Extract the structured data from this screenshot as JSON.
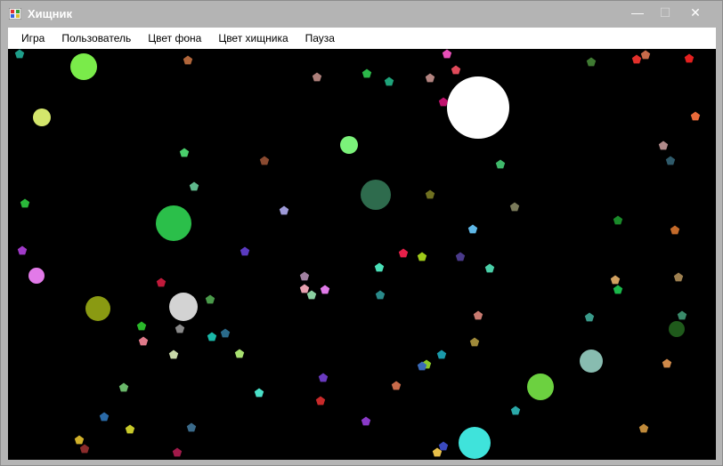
{
  "window": {
    "title": "Хищник",
    "min_symbol": "—",
    "max_symbol": "☐",
    "close_symbol": "✕"
  },
  "menu": {
    "items": [
      "Игра",
      "Пользователь",
      "Цвет фона",
      "Цвет хищника",
      "Пауза"
    ]
  },
  "game": {
    "background_color": "#000000",
    "predators": [
      {
        "color": "#ffffff"
      },
      {
        "color": "#2bbf4a"
      },
      {
        "color": "#2e6b4d"
      },
      {
        "color": "#d3d3d3"
      },
      {
        "color": "#7aeb4a"
      },
      {
        "color": "#d4e66c"
      },
      {
        "color": "#7bf27a"
      },
      {
        "color": "#e27ae8"
      },
      {
        "color": "#8a9a12"
      },
      {
        "color": "#88bcb0"
      },
      {
        "color": "#6cd140"
      },
      {
        "color": "#3fe3db"
      },
      {
        "color": "#1f5a1b"
      }
    ],
    "prey_colors": [
      "#1e9e8a",
      "#b0653a",
      "#e84fb8",
      "#e04a5a",
      "#ad7f7a",
      "#2cb84a",
      "#1fa37a",
      "#b38480",
      "#c0126e",
      "#3f7a32",
      "#e2302b",
      "#c86a4a",
      "#e4201f",
      "#e96a3a",
      "#3fb86a",
      "#8a4a30",
      "#4acf6c",
      "#5fb88c",
      "#2ab83a",
      "#9e9ad8",
      "#6f7020",
      "#7a7a5a",
      "#b08a8a",
      "#2f5a6a",
      "#1a8a2a",
      "#c46a2a",
      "#a03ac8",
      "#5a3ac0",
      "#e8204a",
      "#a0ca1a",
      "#4a3a8a",
      "#5fb8e8",
      "#4ae0b8",
      "#4acfa8",
      "#d0a060",
      "#1ab84a",
      "#9e8050",
      "#c01a3a",
      "#a080a0",
      "#e8a0b0",
      "#e07ae8",
      "#8ad0a0",
      "#2a8a8a",
      "#4a9a4a",
      "#3a8a6a",
      "#c87a70",
      "#3a9a8a",
      "#2ab82a",
      "#8a8a8a",
      "#2a6a8a",
      "#1ab8a8",
      "#e07a8a",
      "#c8d8a8",
      "#a8e070",
      "#1a9aaa",
      "#a08a3a",
      "#8ac82a",
      "#3a6ab8",
      "#6a3ac0",
      "#c86a4a",
      "#6ab86a",
      "#4ae0c8",
      "#c82a2a",
      "#2aa8a8",
      "#2a6aa8",
      "#c8ca2a",
      "#3a6a8a",
      "#8a3ac8",
      "#c08a3a",
      "#d0b02a",
      "#8a2a2a",
      "#a01a4a",
      "#3a4ac0",
      "#e8c04a",
      "#d08a4a"
    ]
  }
}
